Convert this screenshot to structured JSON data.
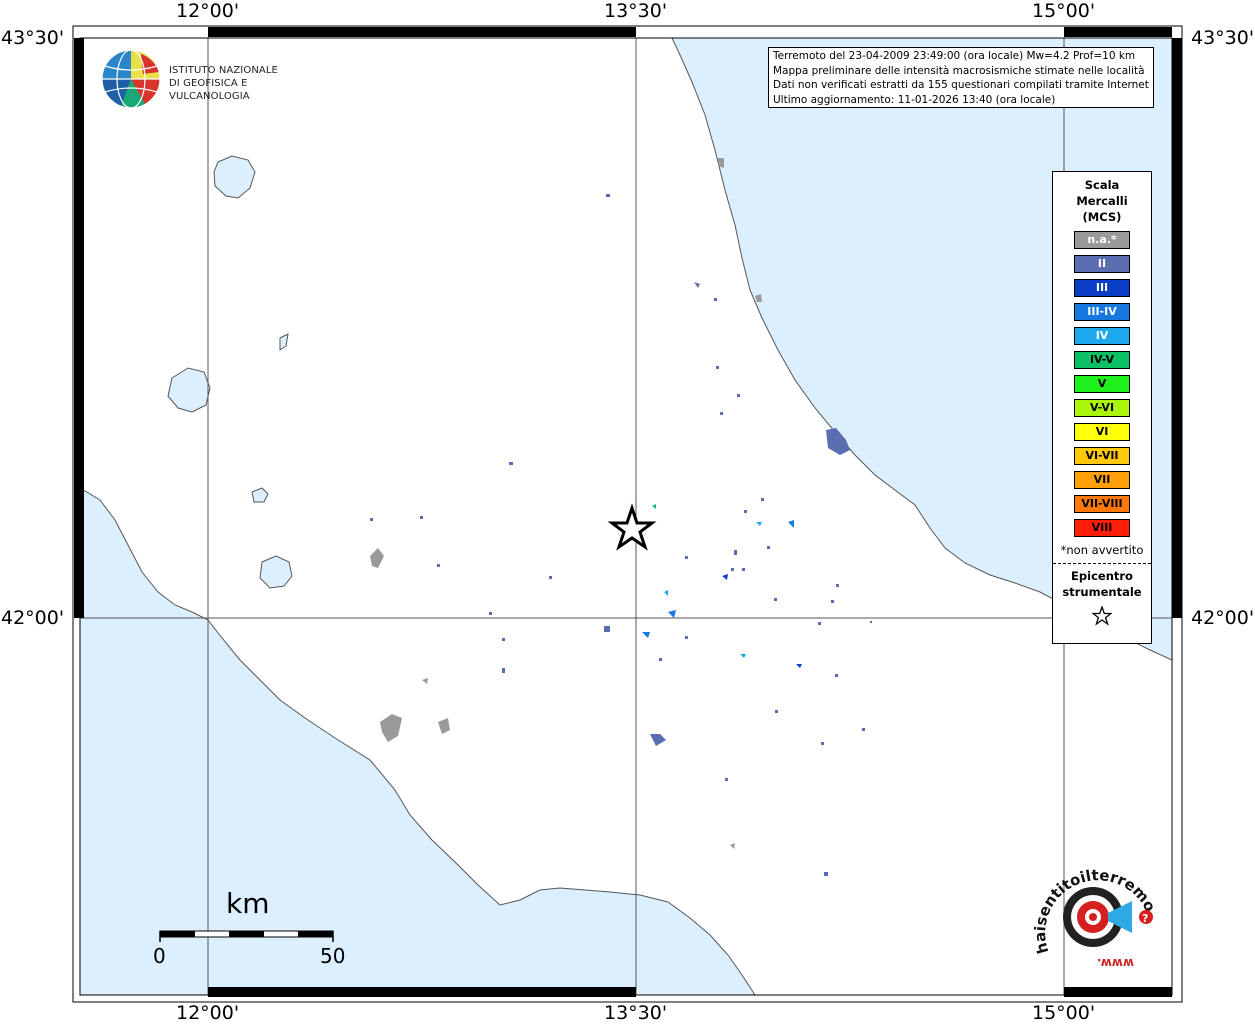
{
  "map": {
    "lon_labels": [
      "12°00'",
      "13°30'",
      "15°00'"
    ],
    "lat_labels": [
      "43°30'",
      "42°00'"
    ],
    "colors": {
      "sea": "#dcefff",
      "land": "#ffffff",
      "coast": "#555555",
      "grid": "#555555"
    }
  },
  "info": {
    "line1": "Terremoto del 23-04-2009 23:49:00 (ora locale) Mw=4.2 Prof=10 km",
    "line2": "Mappa preliminare delle intensità macrosismiche stimate nelle località",
    "line3": "Dati non verificati estratti da 155 questionari compilati tramite Internet.",
    "line4": "Ultimo aggiornamento: 11-01-2026 13:40 (ora locale)"
  },
  "logo": {
    "line1": "ISTITUTO NAZIONALE",
    "line2": "DI GEOFISICA E VULCANOLOGIA"
  },
  "legend": {
    "title_line1": "Scala",
    "title_line2": "Mercalli",
    "title_line3": "(MCS)",
    "items": [
      {
        "label": "n.a.*",
        "color": "#9a9a9a",
        "text_color": "#ffffff"
      },
      {
        "label": "II",
        "color": "#5a6db0",
        "text_color": "#ffffff"
      },
      {
        "label": "III",
        "color": "#0a3ec8",
        "text_color": "#ffffff"
      },
      {
        "label": "III-IV",
        "color": "#1678e0",
        "text_color": "#ffffff"
      },
      {
        "label": "IV",
        "color": "#1ea8ee",
        "text_color": "#ffffff"
      },
      {
        "label": "IV-V",
        "color": "#0bbf64",
        "text_color": "#000000"
      },
      {
        "label": "V",
        "color": "#1ef01e",
        "text_color": "#000000"
      },
      {
        "label": "V-VI",
        "color": "#aaf50a",
        "text_color": "#000000"
      },
      {
        "label": "VI",
        "color": "#ffff0a",
        "text_color": "#000000"
      },
      {
        "label": "VI-VII",
        "color": "#ffc80a",
        "text_color": "#000000"
      },
      {
        "label": "VII",
        "color": "#ffa00a",
        "text_color": "#000000"
      },
      {
        "label": "VII-VIII",
        "color": "#ff780a",
        "text_color": "#000000"
      },
      {
        "label": "VIII",
        "color": "#ff1e0a",
        "text_color": "#000000"
      }
    ],
    "note": "*non avvertito",
    "epicenter_line1": "Epicentro",
    "epicenter_line2": "strumentale"
  },
  "scalebar": {
    "unit": "km",
    "min_label": "0",
    "max_label": "50"
  },
  "watermark": {
    "text": "haisentitoilterremoto.it",
    "url_text": "www."
  }
}
